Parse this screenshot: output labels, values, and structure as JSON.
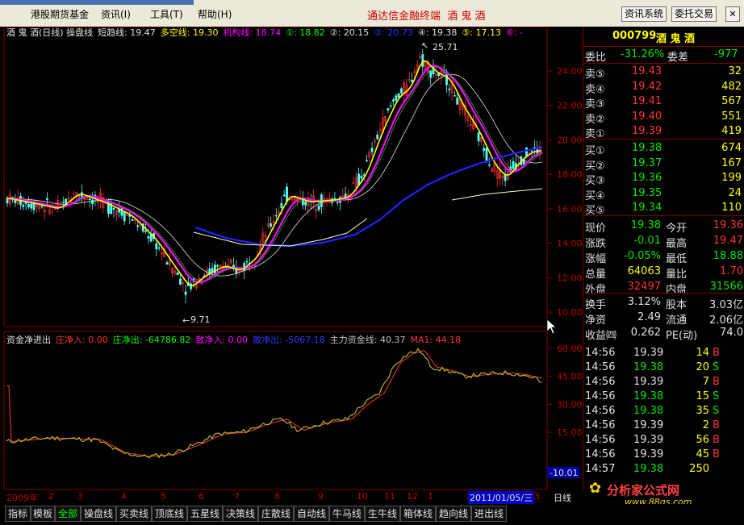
{
  "menu": {
    "items": [
      "港股期货基金",
      "资讯(I)",
      "工具(T)",
      "帮助(H)"
    ],
    "center_title": "通达信金融终端",
    "stock_name_title": "酒 鬼 酒",
    "btn_info": "资讯系统",
    "btn_trade": "委托交易"
  },
  "main_chart": {
    "header": [
      {
        "text": "酒 鬼 酒(日线) 操盘线",
        "color": "#e0e0e0"
      },
      {
        "text": "短趋线: 19.47",
        "color": "#e0e0e0"
      },
      {
        "text": "多空线: 19.30",
        "color": "#ffff00"
      },
      {
        "text": "机构线: 18.74",
        "color": "#ff00ff"
      },
      {
        "text": "①: 18.82",
        "color": "#00ff00"
      },
      {
        "text": "②: 20.15",
        "color": "#e0e0e0"
      },
      {
        "text": "③: 20.73",
        "color": "#3232ff"
      },
      {
        "text": "④: 19.38",
        "color": "#e0e0e0"
      },
      {
        "text": "⑤: 17.13",
        "color": "#ffff00"
      },
      {
        "text": "⑥: -",
        "color": "#ff00ff"
      }
    ],
    "y_ticks": [
      "24.00",
      "22.00",
      "20.00",
      "18.00",
      "16.00",
      "14.00",
      "12.00",
      "10.00"
    ],
    "high_label": "25.71",
    "low_label": "9.71"
  },
  "sub_chart": {
    "header": [
      {
        "text": "资金净进出",
        "color": "#e0e0e0"
      },
      {
        "text": "庄净入: 0.00",
        "color": "#ff3232"
      },
      {
        "text": "庄净出: -64786.82",
        "color": "#00ff00"
      },
      {
        "text": "散净入: 0.00",
        "color": "#ff00ff"
      },
      {
        "text": "散净出: -5067.18",
        "color": "#3232ff"
      },
      {
        "text": "主力资金线: 40.37",
        "color": "#c0c0c0"
      },
      {
        "text": "MA1: 44.18",
        "color": "#ff3232"
      }
    ],
    "y_ticks": [
      "60.00",
      "45.00",
      "30.00",
      "15.00"
    ],
    "current_value": "-10.01"
  },
  "date_axis": {
    "labels": [
      "2009年",
      "2",
      "3",
      "4",
      "5",
      "6",
      "7",
      "8",
      "9",
      "10",
      "11",
      "12",
      "1",
      "2",
      "3"
    ],
    "highlight": "2011/01/05/三",
    "period": "日线"
  },
  "quote": {
    "code": "000799",
    "name": "酒 鬼 酒",
    "weibi_label": "委比",
    "weibi": "-31.26%",
    "weicha_label": "委差",
    "weicha": "-977",
    "sell": [
      {
        "label": "卖⑤",
        "price": "19.43",
        "vol": "32"
      },
      {
        "label": "卖④",
        "price": "19.42",
        "vol": "482"
      },
      {
        "label": "卖③",
        "price": "19.41",
        "vol": "567"
      },
      {
        "label": "卖②",
        "price": "19.40",
        "vol": "551"
      },
      {
        "label": "卖①",
        "price": "19.39",
        "vol": "419"
      }
    ],
    "buy": [
      {
        "label": "买①",
        "price": "19.38",
        "vol": "674"
      },
      {
        "label": "买②",
        "price": "19.37",
        "vol": "167"
      },
      {
        "label": "买③",
        "price": "19.36",
        "vol": "199"
      },
      {
        "label": "买④",
        "price": "19.35",
        "vol": "24"
      },
      {
        "label": "买⑤",
        "price": "19.34",
        "vol": "110"
      }
    ],
    "stats": [
      {
        "l1": "现价",
        "v1": "19.38",
        "c1": "green",
        "l2": "今开",
        "v2": "19.36",
        "c2": "red"
      },
      {
        "l1": "涨跌",
        "v1": "-0.01",
        "c1": "green",
        "l2": "最高",
        "v2": "19.47",
        "c2": "red"
      },
      {
        "l1": "涨幅",
        "v1": "-0.05%",
        "c1": "green",
        "l2": "最低",
        "v2": "18.88",
        "c2": "green"
      },
      {
        "l1": "总量",
        "v1": "64063",
        "c1": "yellow",
        "l2": "量比",
        "v2": "1.70",
        "c2": "red"
      },
      {
        "l1": "外盘",
        "v1": "32497",
        "c1": "red",
        "l2": "内盘",
        "v2": "31566",
        "c2": "green"
      },
      {
        "l1": "换手",
        "v1": "3.12%",
        "c1": "white",
        "l2": "股本",
        "v2": "3.03亿",
        "c2": "white"
      },
      {
        "l1": "净资",
        "v1": "2.49",
        "c1": "white",
        "l2": "流通",
        "v2": "2.06亿",
        "c2": "white"
      },
      {
        "l1": "收益㈣",
        "v1": "0.262",
        "c1": "white",
        "l2": "PE(动)",
        "v2": "74.0",
        "c2": "white"
      }
    ],
    "ticks": [
      {
        "time": "14:56",
        "price": "19.39",
        "pc": "white",
        "vol": "14",
        "flag": "B"
      },
      {
        "time": "14:56",
        "price": "19.38",
        "pc": "green",
        "vol": "20",
        "flag": "S"
      },
      {
        "time": "14:56",
        "price": "19.39",
        "pc": "white",
        "vol": "7",
        "flag": "B"
      },
      {
        "time": "14:56",
        "price": "19.38",
        "pc": "green",
        "vol": "15",
        "flag": "S"
      },
      {
        "time": "14:56",
        "price": "19.38",
        "pc": "green",
        "vol": "35",
        "flag": "S"
      },
      {
        "time": "14:56",
        "price": "19.39",
        "pc": "white",
        "vol": "2",
        "flag": "B"
      },
      {
        "time": "14:56",
        "price": "19.39",
        "pc": "white",
        "vol": "56",
        "flag": "B"
      },
      {
        "time": "14:56",
        "price": "19.39",
        "pc": "white",
        "vol": "45",
        "flag": "B"
      },
      {
        "time": "14:57",
        "price": "19.38",
        "pc": "green",
        "vol": "250",
        "flag": ""
      }
    ]
  },
  "watermark": {
    "name": "分析家公式网",
    "url": "www.88gs.com"
  },
  "tabs": [
    "指标",
    "模板",
    "全部",
    "操盘线",
    "买卖线",
    "顶底线",
    "五星线",
    "决策线",
    "庄散线",
    "自动线",
    "牛马线",
    "生牛线",
    "箱体线",
    "趋向线",
    "进出线"
  ],
  "active_tab": "全部"
}
